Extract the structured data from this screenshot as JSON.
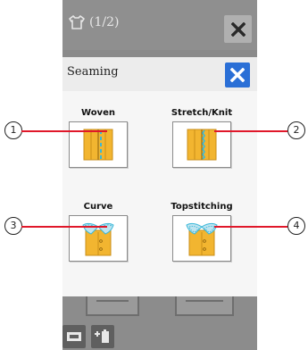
{
  "header": {
    "page_indicator": "(1/2)"
  },
  "popup": {
    "title": "Seaming",
    "options": [
      {
        "label": "Woven"
      },
      {
        "label": "Stretch/Knit"
      },
      {
        "label": "Curve"
      },
      {
        "label": "Topstitching"
      }
    ]
  },
  "callouts": [
    "1",
    "2",
    "3",
    "4"
  ],
  "colors": {
    "fabric": "#f2b530",
    "fabric_dark": "#c98e17",
    "stitch": "#39b8d9",
    "close_blue": "#2a6fd6",
    "callout_line": "#e0182a"
  }
}
